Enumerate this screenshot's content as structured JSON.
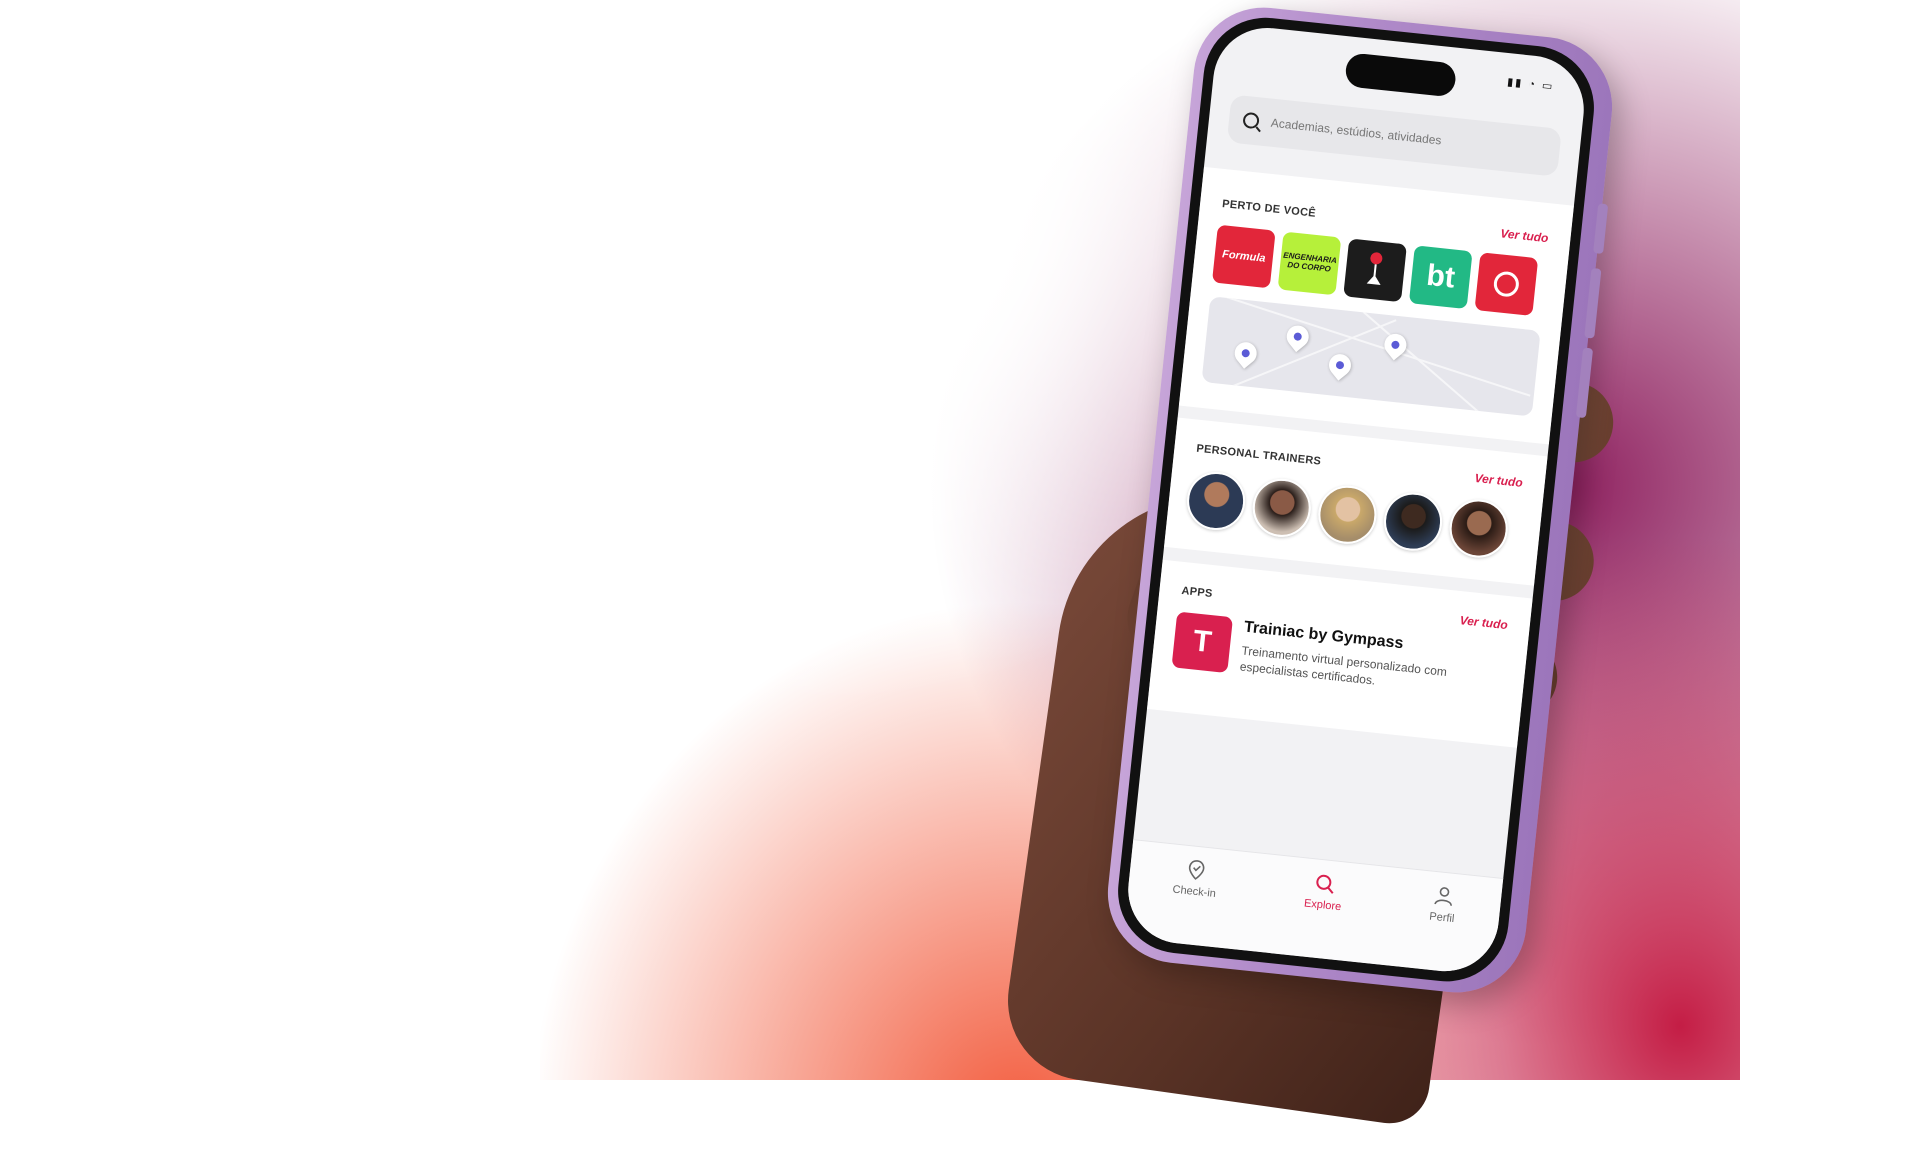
{
  "search": {
    "placeholder": "Academias, estúdios, atividades"
  },
  "nearby": {
    "title": "PERTO DE VOCÊ",
    "see_all": "Ver tudo",
    "gyms": [
      {
        "name": "Formula",
        "label": "Formula",
        "color": "#e2263a",
        "text_color": "#ffffff"
      },
      {
        "name": "Engenharia do Corpo",
        "label": "ENGENHARIA DO CORPO",
        "color": "#b6f03a",
        "text_color": "#1a1a1a"
      },
      {
        "name": "gym-3",
        "label": "",
        "color": "#1c1c1c",
        "text_color": "#ffffff"
      },
      {
        "name": "bt",
        "label": "bt",
        "color": "#22b985",
        "text_color": "#ffffff"
      },
      {
        "name": "gym-5",
        "label": "",
        "color": "#e2263a",
        "text_color": "#ffffff"
      }
    ]
  },
  "trainers": {
    "title": "PERSONAL TRAINERS",
    "see_all": "Ver tudo",
    "avatar_colors": [
      "#5a6f8a",
      "#8a5a46",
      "#c9a86a",
      "#2e3d55",
      "#6b4537"
    ]
  },
  "apps": {
    "title": "APPS",
    "see_all": "Ver tudo",
    "app": {
      "icon_letter": "T",
      "name": "Trainiac by Gympass",
      "description": "Treinamento virtual personalizado com especialistas certificados."
    }
  },
  "tabbar": {
    "tabs": [
      {
        "label": "Check-in",
        "icon": "check-in-pin-icon",
        "active": false
      },
      {
        "label": "Explore",
        "icon": "search-icon",
        "active": true
      },
      {
        "label": "Perfil",
        "icon": "person-icon",
        "active": false
      }
    ]
  },
  "colors": {
    "accent": "#d9204f",
    "phone": "#b08ac9"
  }
}
